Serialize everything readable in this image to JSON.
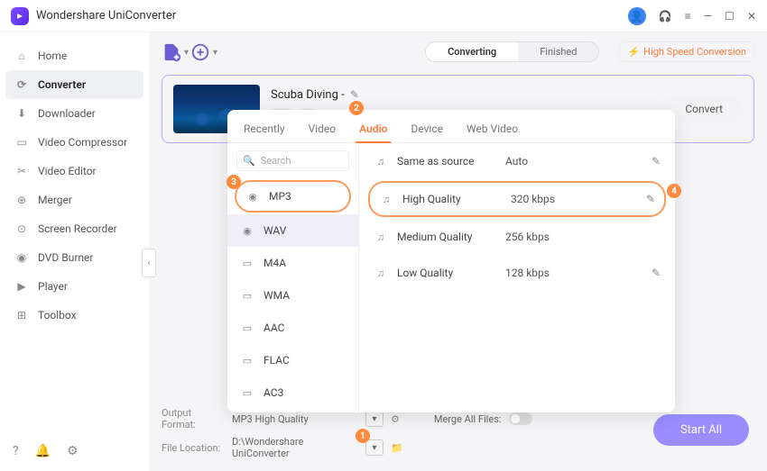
{
  "app": {
    "title": "Wondershare UniConverter"
  },
  "sidebar": {
    "items": [
      {
        "icon": "home-icon",
        "label": "Home"
      },
      {
        "icon": "converter-icon",
        "label": "Converter"
      },
      {
        "icon": "downloader-icon",
        "label": "Downloader"
      },
      {
        "icon": "compressor-icon",
        "label": "Video Compressor"
      },
      {
        "icon": "editor-icon",
        "label": "Video Editor"
      },
      {
        "icon": "merger-icon",
        "label": "Merger"
      },
      {
        "icon": "recorder-icon",
        "label": "Screen Recorder"
      },
      {
        "icon": "dvd-icon",
        "label": "DVD Burner"
      },
      {
        "icon": "player-icon",
        "label": "Player"
      },
      {
        "icon": "toolbox-icon",
        "label": "Toolbox"
      }
    ]
  },
  "toolbar": {
    "segments": {
      "converting": "Converting",
      "finished": "Finished"
    },
    "hsp": "High Speed Conversion"
  },
  "file": {
    "title": "Scuba Diving - ",
    "cut_label": "✂",
    "convert": "Convert"
  },
  "dropdown": {
    "tabs": [
      "Recently",
      "Video",
      "Audio",
      "Device",
      "Web Video"
    ],
    "active_tab": "Audio",
    "search_placeholder": "Search",
    "formats": [
      "MP3",
      "WAV",
      "M4A",
      "WMA",
      "AAC",
      "FLAC",
      "AC3"
    ],
    "selected_format": "MP3",
    "qualities": [
      {
        "name": "Same as source",
        "meta": "Auto",
        "editable": true
      },
      {
        "name": "High Quality",
        "meta": "320 kbps",
        "editable": true
      },
      {
        "name": "Medium Quality",
        "meta": "256 kbps",
        "editable": false
      },
      {
        "name": "Low Quality",
        "meta": "128 kbps",
        "editable": true
      }
    ],
    "selected_quality": "High Quality"
  },
  "footer": {
    "output_label": "Output Format:",
    "output_value": "MP3 High Quality",
    "merge_label": "Merge All Files:",
    "location_label": "File Location:",
    "location_value": "D:\\Wondershare UniConverter"
  },
  "startall": "Start All",
  "callouts": {
    "1": "1",
    "2": "2",
    "3": "3",
    "4": "4"
  }
}
